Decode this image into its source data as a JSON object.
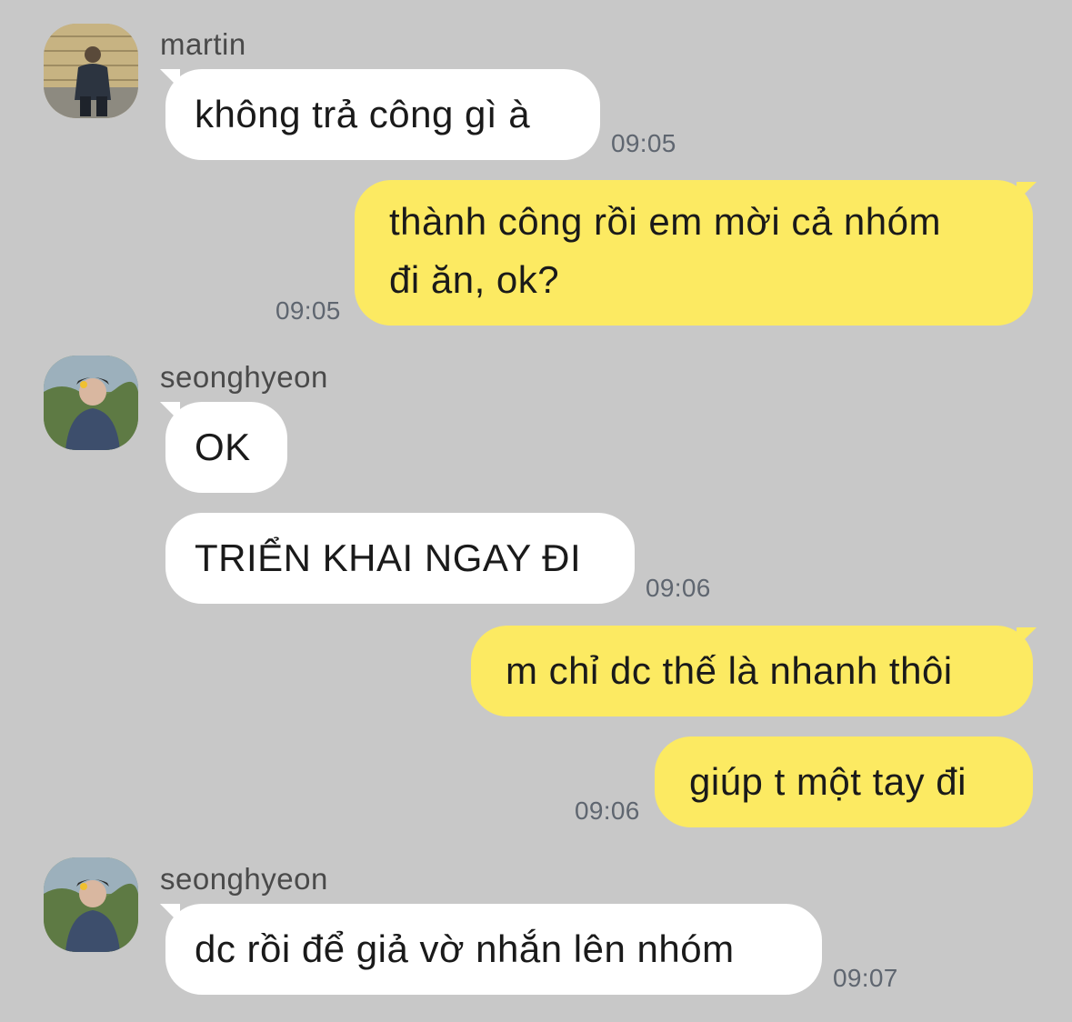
{
  "messages": [
    {
      "sender": "martin",
      "text": "không trả công gì à",
      "time": "09:05"
    },
    {
      "text_line1": "thành công rồi em mời cả nhóm",
      "text_line2": "đi ăn, ok?",
      "time": "09:05"
    },
    {
      "sender": "seonghyeon",
      "text": "OK"
    },
    {
      "text": "TRIỂN KHAI NGAY ĐI",
      "time": "09:06"
    },
    {
      "text": "m chỉ dc thế là nhanh thôi"
    },
    {
      "text": "giúp t một tay đi",
      "time": "09:06"
    },
    {
      "sender": "seonghyeon",
      "text": "dc rồi để giả vờ nhắn lên nhóm",
      "time": "09:07"
    }
  ],
  "colors": {
    "background": "#c8c8c8",
    "incoming_bubble": "#ffffff",
    "outgoing_bubble": "#fcea62"
  }
}
